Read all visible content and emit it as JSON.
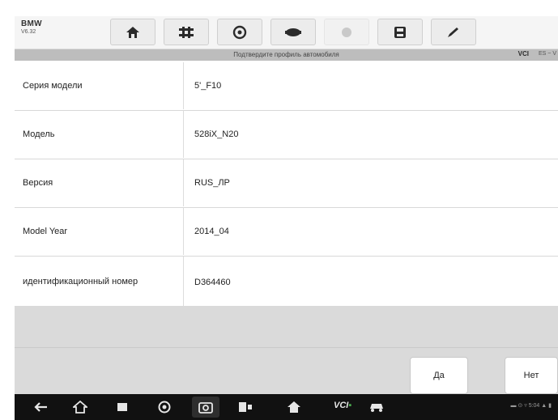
{
  "brand": {
    "name": "BMW",
    "version": "V6.32"
  },
  "toolbar": {
    "buttons": [
      {
        "icon": "home-icon",
        "enabled": true
      },
      {
        "icon": "vehicle-swap-icon",
        "enabled": true
      },
      {
        "icon": "settings-icon",
        "enabled": true
      },
      {
        "icon": "car-icon",
        "enabled": true
      },
      {
        "icon": "record-icon",
        "enabled": false
      },
      {
        "icon": "save-icon",
        "enabled": true
      },
      {
        "icon": "pen-icon",
        "enabled": true
      }
    ]
  },
  "caption": {
    "text": "Подтвердите профиль автомобиля",
    "vci": "VCI",
    "status": "ES ~ V"
  },
  "rows": [
    {
      "label": "Серия модели",
      "value": "5'_F10"
    },
    {
      "label": "Модель",
      "value": "528iX_N20"
    },
    {
      "label": "Версия",
      "value": "RUS_ЛР"
    },
    {
      "label": "Model Year",
      "value": "2014_04"
    },
    {
      "label": "идентификационный номер",
      "value": "D364460"
    }
  ],
  "actions": {
    "yes": "Да",
    "no": "Нет"
  },
  "navbar": {
    "vci": "VCI",
    "status": "▬ ⊙ ▿ 5:04 ▲ ▮"
  }
}
